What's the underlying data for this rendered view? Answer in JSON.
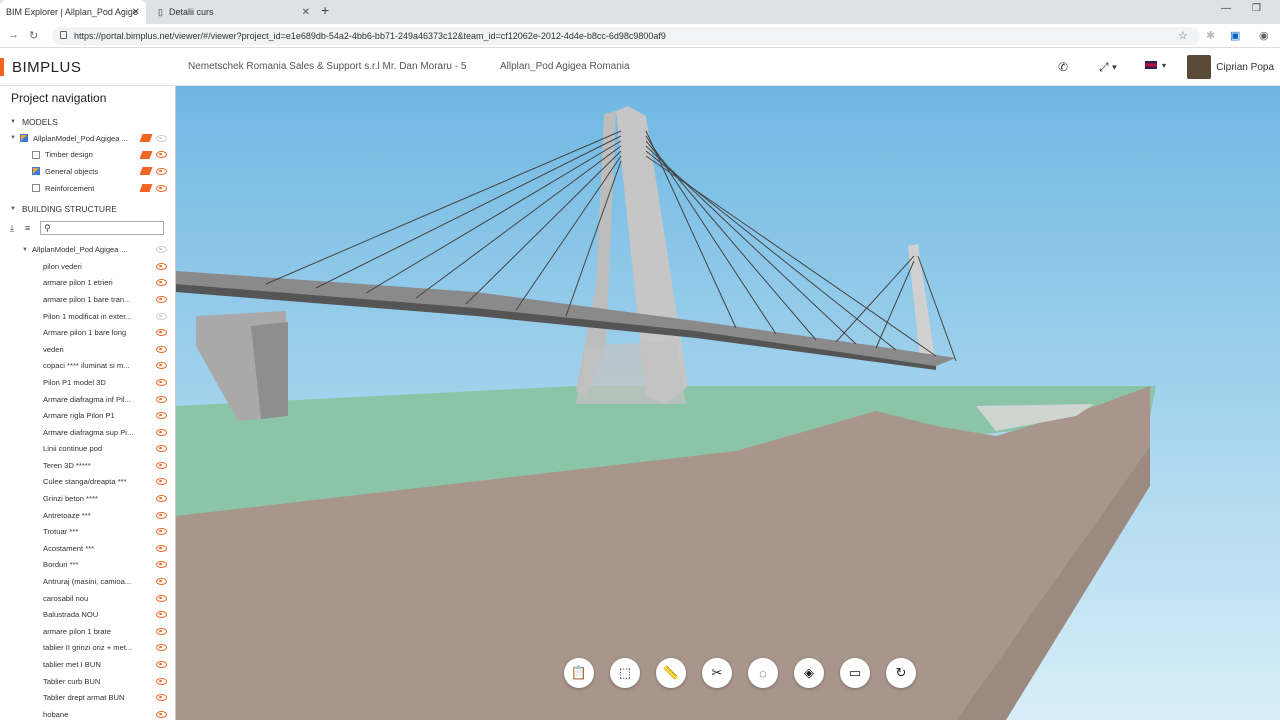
{
  "browser": {
    "tabs": [
      {
        "title": "BIM Explorer | Allplan_Pod Agige"
      },
      {
        "title": "Detalii curs"
      }
    ],
    "url": "https://portal.bimplus.net/viewer/#/viewer?project_id=e1e689db-54a2-4bb6-bb71-249a46373c12&team_id=cf12062e-2012-4d4e-b8cc-6d98c9800af9"
  },
  "header": {
    "logo": "BIMPLUS",
    "team": "Nemetschek Romania Sales & Support s.r.l Mr. Dan Moraru - 5",
    "project": "Allplan_Pod Agigea Romania",
    "user": "Ciprian Popa",
    "accent": "#f26522"
  },
  "sidebar": {
    "title": "Project navigation",
    "models_header": "MODELS",
    "models": [
      {
        "label": "AllplanModel_Pod Agigea ...",
        "checked": true
      },
      {
        "label": "Timber design",
        "checked": false
      },
      {
        "label": "General objects",
        "checked": true
      },
      {
        "label": "Reinforcement",
        "checked": false
      }
    ],
    "structure_header": "BUILDING STRUCTURE",
    "search_placeholder": "",
    "root": "AllplanModel_Pod Agigea R...",
    "items": [
      {
        "label": "pilon vederi",
        "visible": true
      },
      {
        "label": "armare pilon 1 etrieri",
        "visible": true
      },
      {
        "label": "armare pilon 1 bare tran...",
        "visible": true
      },
      {
        "label": "Pilon 1 modificat in exter...",
        "visible": false
      },
      {
        "label": "Armare pilon 1 bare long",
        "visible": true
      },
      {
        "label": "vederi",
        "visible": true
      },
      {
        "label": "copaci **** iluminat si m...",
        "visible": true
      },
      {
        "label": "Pilon P1 model 3D",
        "visible": true
      },
      {
        "label": "Armare diafragma inf Pil...",
        "visible": true
      },
      {
        "label": "Armare rigla Pilon P1",
        "visible": true
      },
      {
        "label": "Armare diafragma sup Pi...",
        "visible": true
      },
      {
        "label": "Linii continue pod",
        "visible": true
      },
      {
        "label": "Teren 3D *****",
        "visible": true
      },
      {
        "label": "Culee stanga/dreapta ***",
        "visible": true
      },
      {
        "label": "Grinzi beton ****",
        "visible": true
      },
      {
        "label": "Antretoaze ***",
        "visible": true
      },
      {
        "label": "Trotuar ***",
        "visible": true
      },
      {
        "label": "Acostament ***",
        "visible": true
      },
      {
        "label": "Borduri ***",
        "visible": true
      },
      {
        "label": "Antruraj (masini, camioa...",
        "visible": true
      },
      {
        "label": "carosabil nou",
        "visible": true
      },
      {
        "label": "Balustrada NOU",
        "visible": true
      },
      {
        "label": "armare pilon 1 brate",
        "visible": true
      },
      {
        "label": "tablier II grinzi oriz + met...",
        "visible": true
      },
      {
        "label": "tablier met I BUN",
        "visible": true
      },
      {
        "label": "Tablier curb BUN",
        "visible": true
      },
      {
        "label": "Tablier drept armat BUN",
        "visible": true
      },
      {
        "label": "hobane",
        "visible": true
      }
    ]
  },
  "toolbar": {
    "icons": [
      "clipboard-icon",
      "select-box-icon",
      "measure-icon",
      "cut-icon",
      "hide-icon",
      "layers-icon",
      "camera-icon",
      "reset-icon"
    ]
  }
}
